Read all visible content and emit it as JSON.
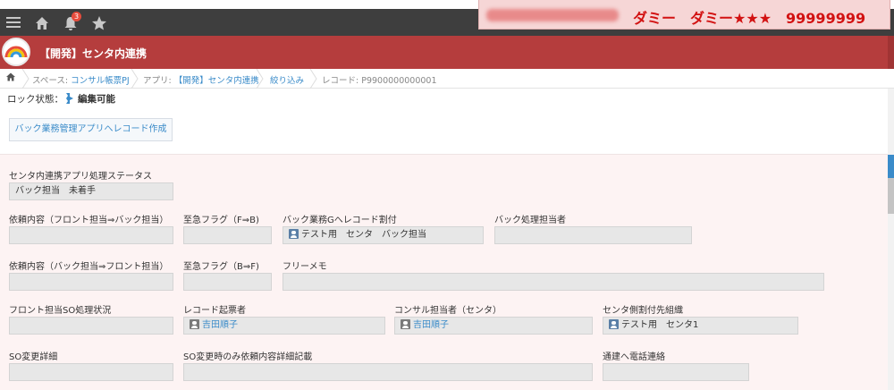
{
  "header": {
    "notification_count": "3",
    "user_text": "ダミー　ダミー★★★　99999999"
  },
  "app": {
    "title": "【開発】センタ内連携"
  },
  "breadcrumb": {
    "space_prefix": "スペース: ",
    "space": "コンサル帳票PJ",
    "app_prefix": "アプリ: ",
    "app": "【開発】センタ内連携",
    "filter": "絞り込み",
    "record": "レコード: P9900000000001"
  },
  "lock": {
    "label": "ロック状態：",
    "value": "編集可能"
  },
  "actions": {
    "create_record": "バック業務管理アプリへレコード作成"
  },
  "fields": {
    "status_label": "センタ内連携アプリ処理ステータス",
    "status_value": "バック担当　未着手",
    "req_front_back_label": "依頼内容（フロント担当⇒バック担当）",
    "urgent_fb_label": "至急フラグ（F⇒B)",
    "back_group_label": "バック業務Gへレコード割付",
    "back_group_value": "テスト用　センタ　バック担当",
    "back_owner_label": "バック処理担当者",
    "req_back_front_label": "依頼内容（バック担当⇒フロント担当）",
    "urgent_bf_label": "至急フラグ（B⇒F)",
    "memo_label": "フリーメモ",
    "front_so_label": "フロント担当SO処理状況",
    "creator_label": "レコード起票者",
    "creator_value": "吉田順子",
    "consultant_label": "コンサル担当者（センタ）",
    "consultant_value": "吉田順子",
    "center_dest_label": "センタ側割付先組織",
    "center_dest_value": "テスト用　センタ1",
    "so_detail_label": "SO変更詳細",
    "so_only_label": "SO変更時のみ依頼内容詳細記載",
    "phone_label": "通建へ電話連絡"
  },
  "colors": {
    "header_bg": "#3e3e3e",
    "app_bar": "#b53d3d",
    "user_text": "#d21212",
    "link": "#3a8bc9",
    "record_bg": "#fdf3f3"
  }
}
